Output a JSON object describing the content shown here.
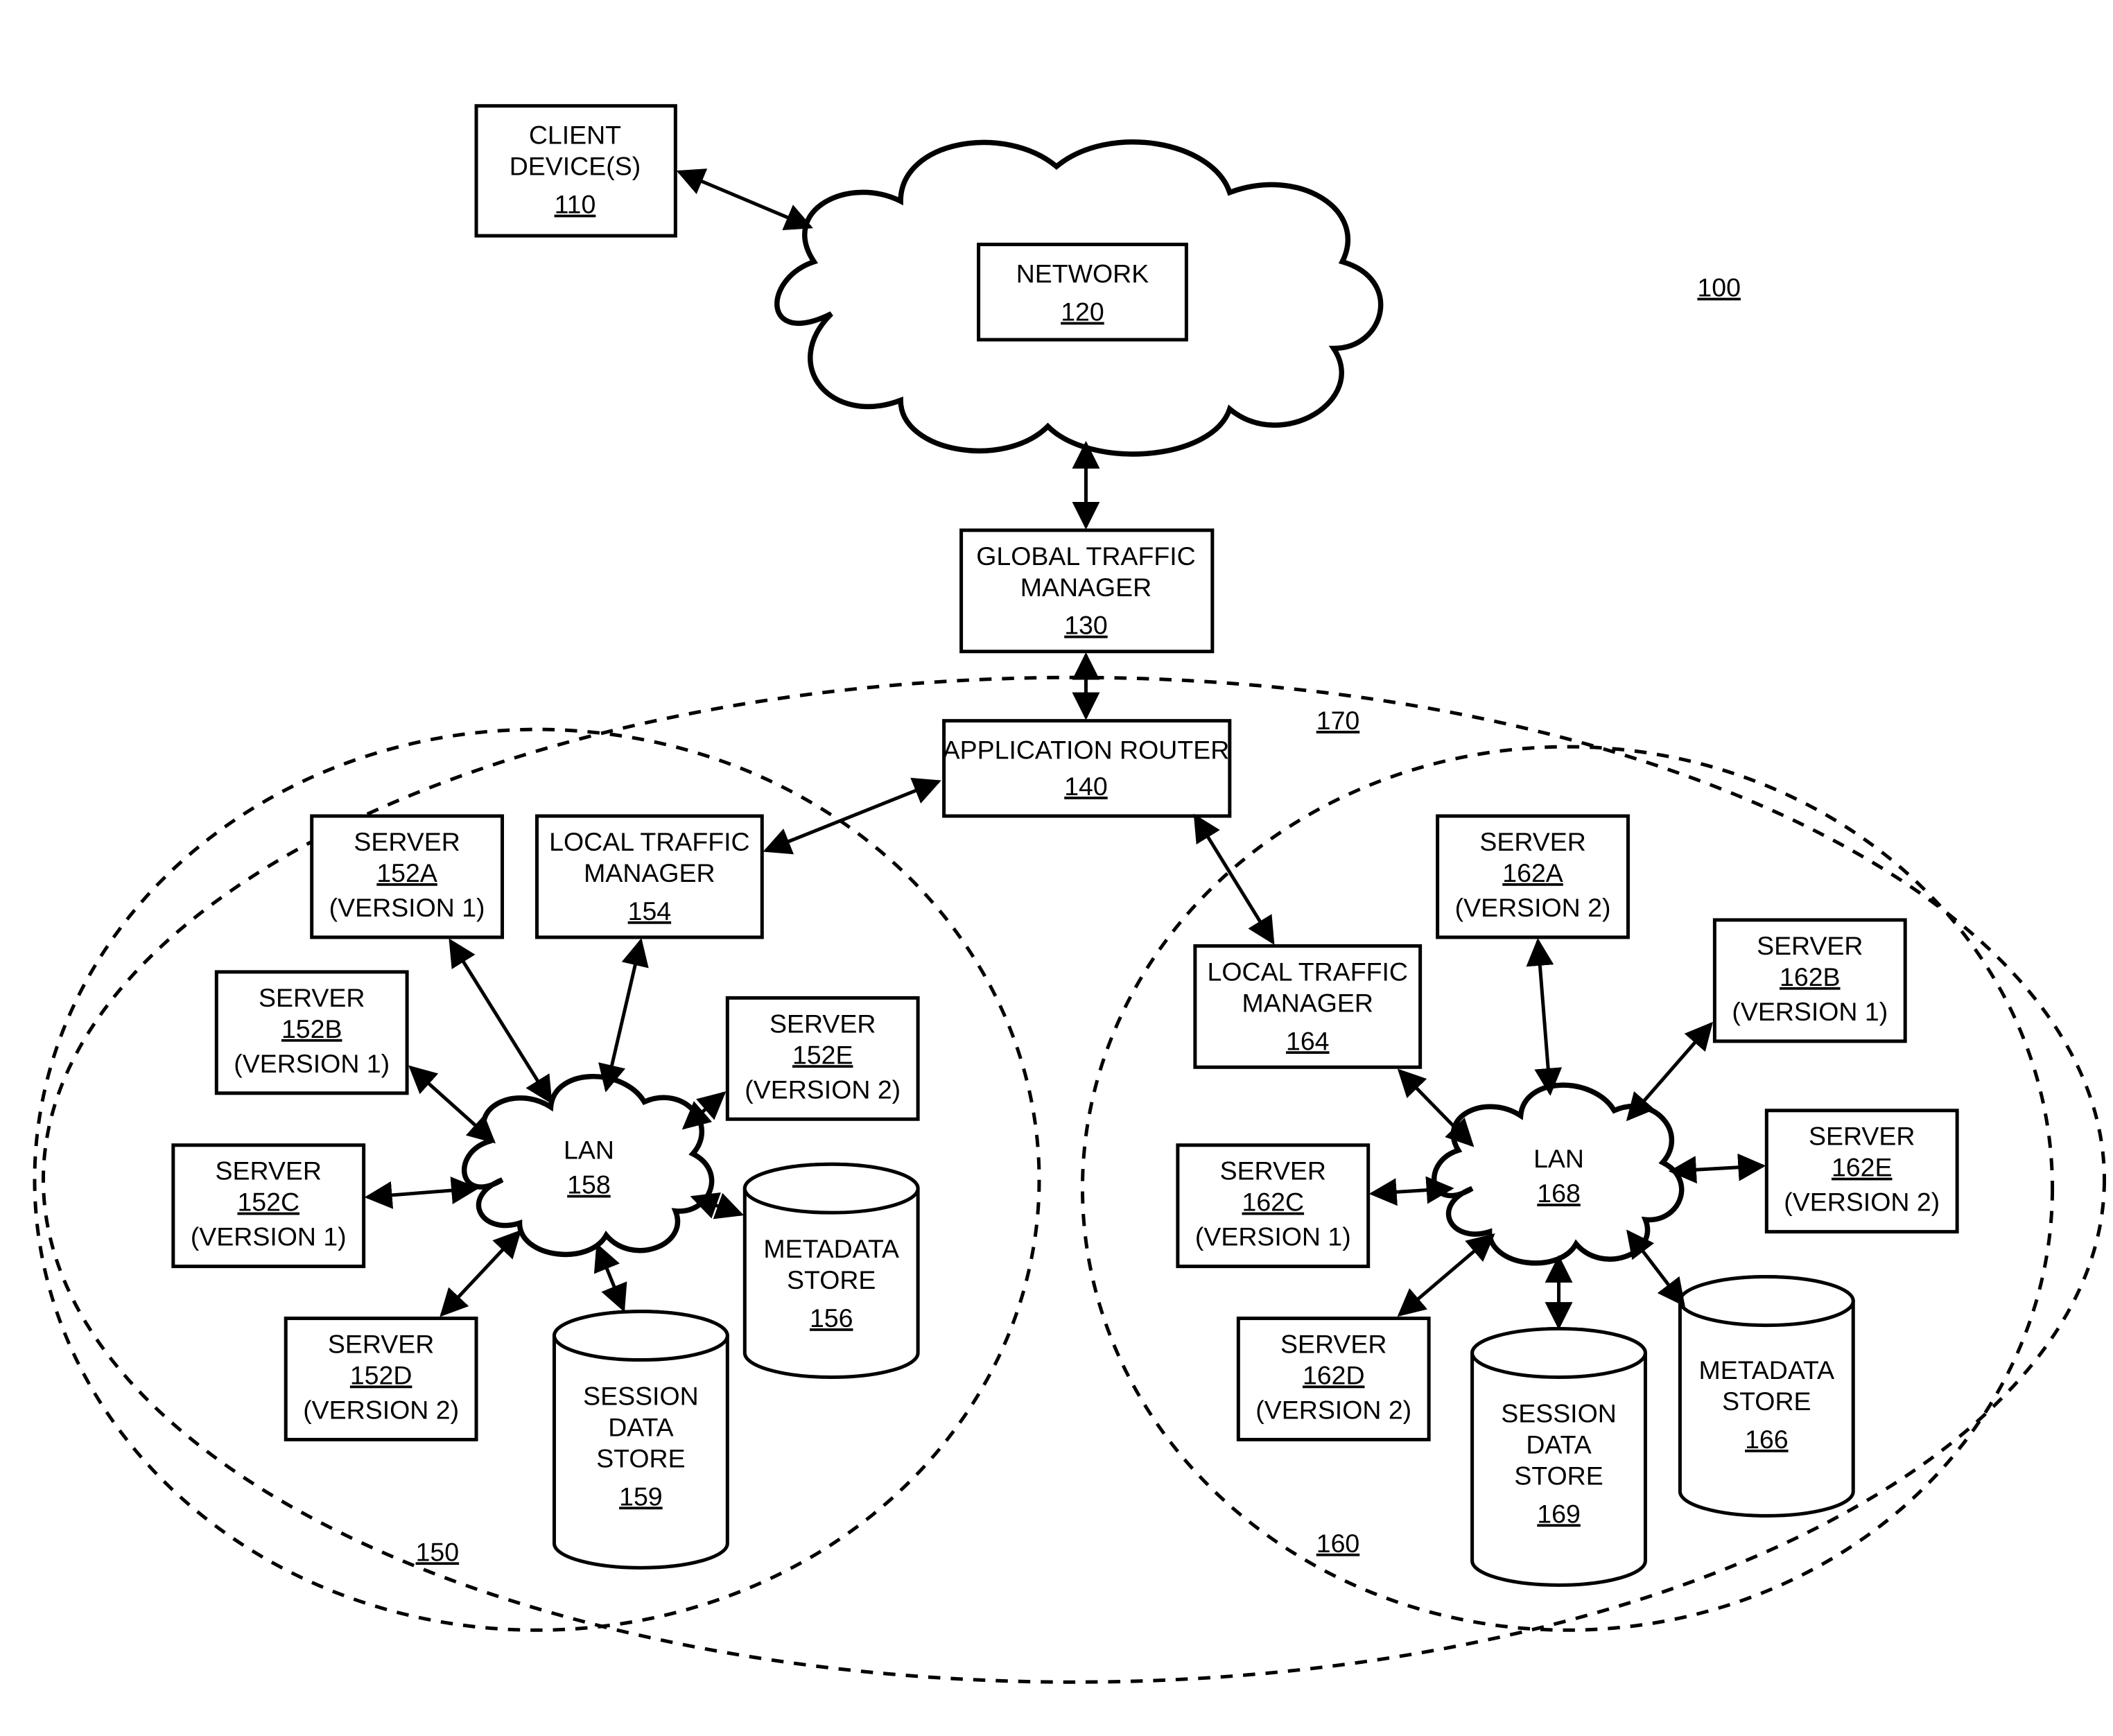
{
  "systemRef": "100",
  "client": {
    "l1": "CLIENT",
    "l2": "DEVICE(S)",
    "ref": "110"
  },
  "network": {
    "l1": "NETWORK",
    "ref": "120"
  },
  "gtm": {
    "l1": "GLOBAL TRAFFIC",
    "l2": "MANAGER",
    "ref": "130"
  },
  "appRouter": {
    "l1": "APPLICATION ROUTER",
    "ref": "140"
  },
  "outerRef": "170",
  "left": {
    "ref": "150",
    "ltm": {
      "l1": "LOCAL TRAFFIC",
      "l2": "MANAGER",
      "ref": "154"
    },
    "lan": {
      "l1": "LAN",
      "ref": "158"
    },
    "servers": {
      "A": {
        "l1": "SERVER",
        "ref": "152A",
        "ver": "(VERSION 1)"
      },
      "B": {
        "l1": "SERVER",
        "ref": "152B",
        "ver": "(VERSION 1)"
      },
      "C": {
        "l1": "SERVER",
        "ref": "152C",
        "ver": "(VERSION 1)"
      },
      "D": {
        "l1": "SERVER",
        "ref": "152D",
        "ver": "(VERSION 2)"
      },
      "E": {
        "l1": "SERVER",
        "ref": "152E",
        "ver": "(VERSION 2)"
      }
    },
    "meta": {
      "l1": "METADATA",
      "l2": "STORE",
      "ref": "156"
    },
    "session": {
      "l1": "SESSION",
      "l2": "DATA",
      "l3": "STORE",
      "ref": "159"
    }
  },
  "right": {
    "ref": "160",
    "ltm": {
      "l1": "LOCAL TRAFFIC",
      "l2": "MANAGER",
      "ref": "164"
    },
    "lan": {
      "l1": "LAN",
      "ref": "168"
    },
    "servers": {
      "A": {
        "l1": "SERVER",
        "ref": "162A",
        "ver": "(VERSION 2)"
      },
      "B": {
        "l1": "SERVER",
        "ref": "162B",
        "ver": "(VERSION 1)"
      },
      "C": {
        "l1": "SERVER",
        "ref": "162C",
        "ver": "(VERSION 1)"
      },
      "D": {
        "l1": "SERVER",
        "ref": "162D",
        "ver": "(VERSION 2)"
      },
      "E": {
        "l1": "SERVER",
        "ref": "162E",
        "ver": "(VERSION 2)"
      }
    },
    "meta": {
      "l1": "METADATA",
      "l2": "STORE",
      "ref": "166"
    },
    "session": {
      "l1": "SESSION",
      "l2": "DATA",
      "l3": "STORE",
      "ref": "169"
    }
  }
}
